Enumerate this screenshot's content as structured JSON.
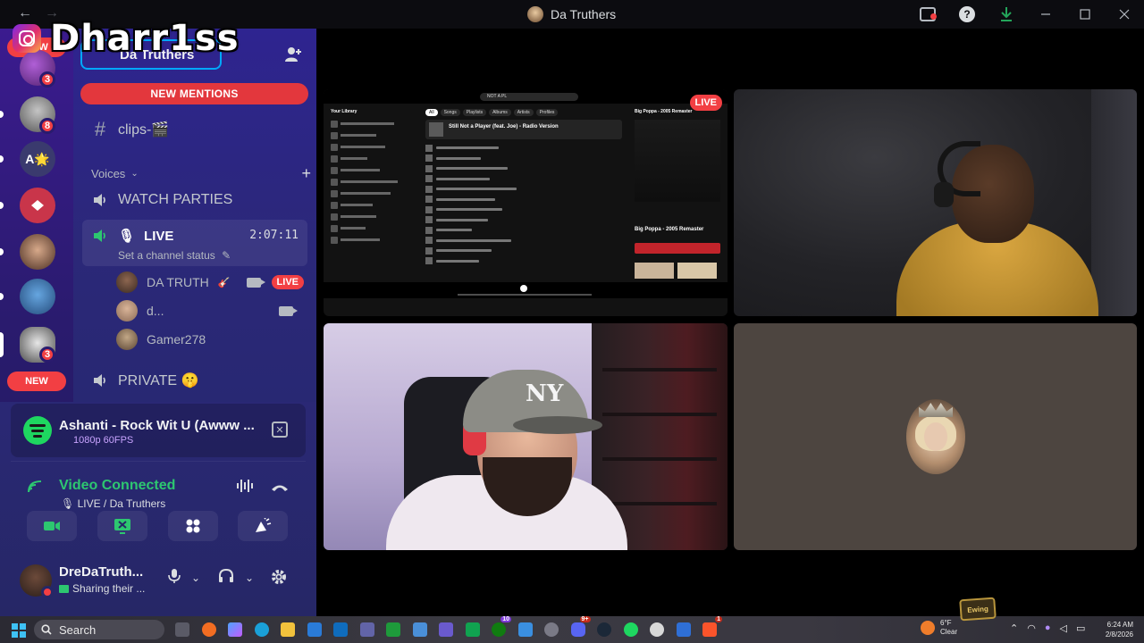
{
  "watermark": {
    "text": "Dharr1ss"
  },
  "titlebar": {
    "title": "Da Truthers",
    "help_glyph": "?"
  },
  "rail": {
    "new_top": "NEW",
    "new_bottom": "NEW",
    "badges": [
      "3",
      "8",
      "3"
    ],
    "text_server": "A🌟"
  },
  "channels": {
    "server_name": "Da Truthers",
    "new_mentions": "NEW MENTIONS",
    "clips_channel": "clips-🎬",
    "voices_category": "Voices",
    "watch_parties": "WATCH PARTIES",
    "live_channel": {
      "name": "LIVE",
      "timer": "2:07:11",
      "status": "Set a channel status"
    },
    "voice_users": [
      {
        "name": "DA TRUTH",
        "badge": "LIVE"
      },
      {
        "name": "d..."
      },
      {
        "name": "Gamer278"
      }
    ],
    "private_channel": "PRIVATE 🤫"
  },
  "activity": {
    "song": "Ashanti - Rock Wit U (Awww ...",
    "quality": "1080p 60FPS"
  },
  "rtc": {
    "status": "Video Connected",
    "location": "LIVE / Da Truthers"
  },
  "user_panel": {
    "username": "DreDaTruth...",
    "status": "Sharing their ..."
  },
  "call": {
    "stream_badge": "LIVE",
    "spotify": {
      "search_value": "NOT A PL",
      "top_result": "Still Not a Player (feat. Joe) - Radio Version",
      "library_label": "Your Library",
      "now_playing": "Big Poppa - 2005 Remaster",
      "now_playing_short": "Big Poppa - 2005 Remaster",
      "chips": [
        "All",
        "Songs",
        "Playlists",
        "Albums",
        "Artists",
        "Profiles"
      ]
    }
  },
  "taskbar": {
    "search": "Search",
    "weather_temp": "6°F",
    "weather_desc": "Clear",
    "time": "6:24 AM",
    "date": "2/8/2026",
    "streamer_logo": "Ewing"
  },
  "colors": {
    "accent_red": "#f23f43",
    "connected_green": "#2dc770",
    "rail_purple": "#2a1b6e"
  }
}
